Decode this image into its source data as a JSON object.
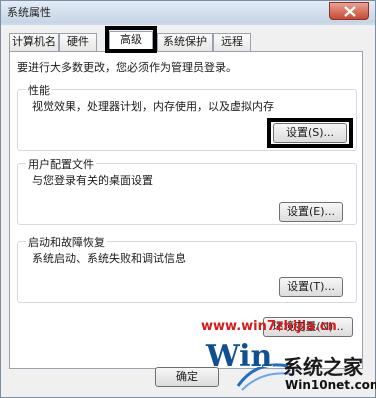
{
  "window": {
    "title": "系统属性"
  },
  "tabs": [
    {
      "label": "计算机名"
    },
    {
      "label": "硬件"
    },
    {
      "label": "高级"
    },
    {
      "label": "系统保护"
    },
    {
      "label": "远程"
    }
  ],
  "notice": "要进行大多数更改，您必须作为管理员登录。",
  "performance": {
    "title": "性能",
    "description": "视觉效果，处理器计划，内存使用，以及虚拟内存",
    "button": "设置(S)..."
  },
  "user_profiles": {
    "title": "用户配置文件",
    "description": "与您登录有关的桌面设置",
    "button": "设置(E)..."
  },
  "startup_recovery": {
    "title": "启动和故障恢复",
    "description": "系统启动、系统失败和调试信息",
    "button": "设置(T)..."
  },
  "env_button": "环境变量(N)...",
  "ok_button": "确定",
  "watermark": "www.win7zhijia.cn",
  "logo": {
    "win_text": "Win",
    "brand_cn": "系统之家",
    "url": "Win10net.com"
  }
}
